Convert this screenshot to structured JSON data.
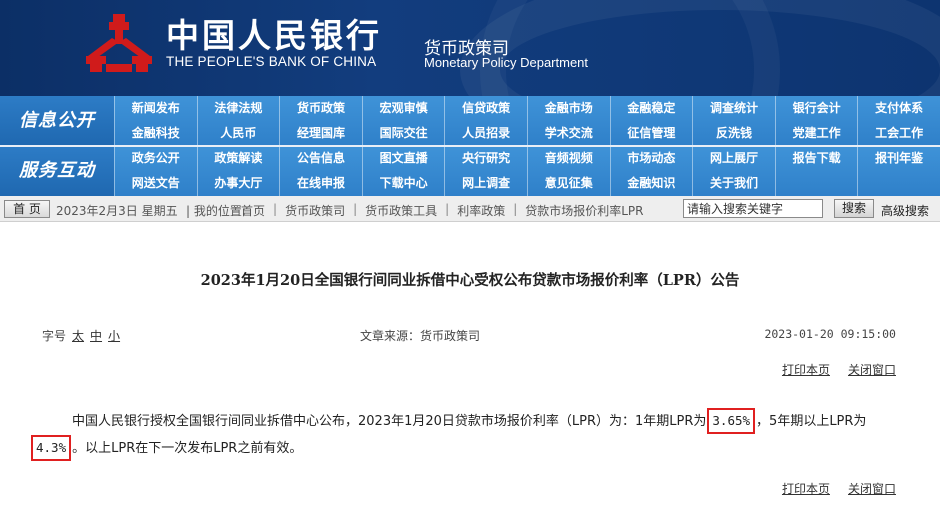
{
  "header": {
    "bank_cn": "中国人民银行",
    "bank_en": "THE PEOPLE'S BANK OF CHINA",
    "dept_cn": "货币政策司",
    "dept_en": "Monetary Policy Department",
    "emblem_color": "#d01b1b"
  },
  "nav": {
    "info": {
      "title": "信息公开",
      "items": [
        "新闻发布",
        "法律法规",
        "货币政策",
        "宏观审慎",
        "信贷政策",
        "金融市场",
        "金融稳定",
        "调查统计",
        "银行会计",
        "支付体系",
        "金融科技",
        "人民币",
        "经理国库",
        "国际交往",
        "人员招录",
        "学术交流",
        "征信管理",
        "反洗钱",
        "党建工作",
        "工会工作"
      ]
    },
    "service": {
      "title": "服务互动",
      "items": [
        "政务公开",
        "政策解读",
        "公告信息",
        "图文直播",
        "央行研究",
        "音频视频",
        "市场动态",
        "网上展厅",
        "报告下载",
        "报刊年鉴",
        "网送文告",
        "办事大厅",
        "在线申报",
        "下载中心",
        "网上调查",
        "意见征集",
        "金融知识",
        "关于我们",
        "",
        ""
      ]
    },
    "color": "#3c8fd3"
  },
  "toolbar": {
    "home": "首 页",
    "date": "2023年2月3日 星期五",
    "location_label": "| 我的位置:",
    "crumbs": [
      "首页",
      "货币政策司",
      "货币政策工具",
      "利率政策",
      "贷款市场报价利率LPR"
    ],
    "search_placeholder": "请输入搜索关键字",
    "search_button": "搜索",
    "advanced_search": "高级搜索"
  },
  "article": {
    "title": "2023年1月20日全国银行间同业拆借中心受权公布贷款市场报价利率（LPR）公告",
    "font_label": "字号",
    "font_sizes": [
      "太",
      "中",
      "小"
    ],
    "source": "文章来源：货币政策司",
    "date": "2023-01-20 09:15:00",
    "print": "打印本页",
    "close": "关闭窗口",
    "body_part1": "中国人民银行授权全国银行间同业拆借中心公布，2023年1月20日贷款市场报价利率（LPR）为：1年期LPR为",
    "rate_1y": "3.65%",
    "body_part2": "，5年期以上LPR为",
    "rate_5y": "4.3%",
    "body_part3": "。以上LPR在下一次发布LPR之前有效。",
    "highlight_color": "#e02020"
  }
}
